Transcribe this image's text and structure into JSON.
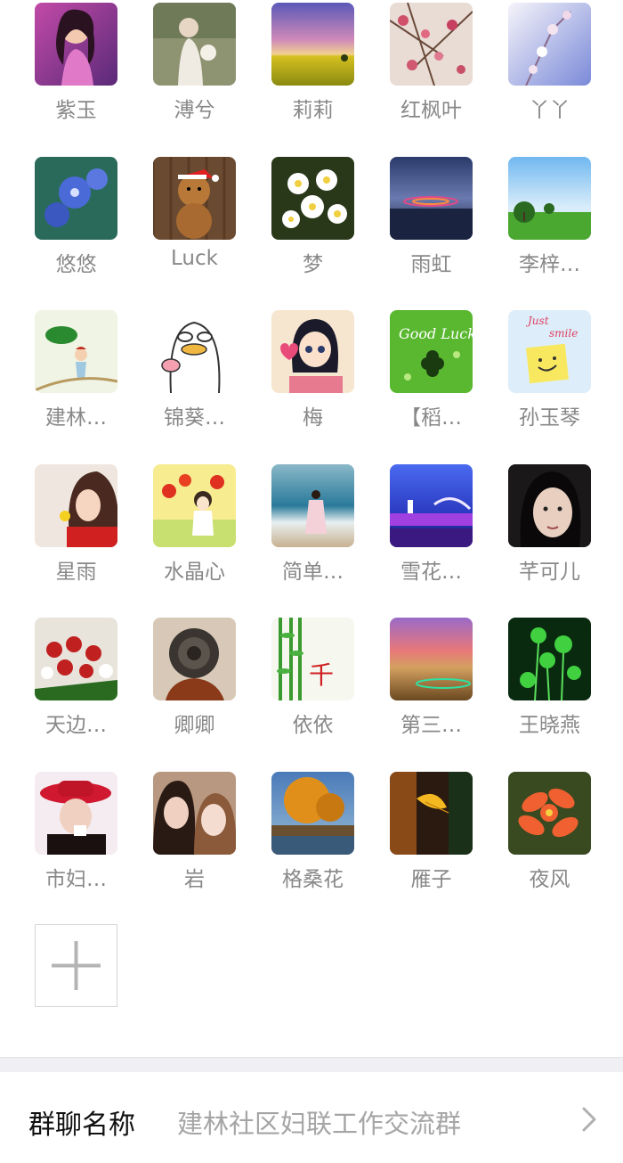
{
  "members": [
    {
      "name": "紫玉",
      "avatar": "portrait-cartoon-girl"
    },
    {
      "name": "溥兮",
      "avatar": "woman-with-flowers"
    },
    {
      "name": "莉莉",
      "avatar": "sunset-field"
    },
    {
      "name": "红枫叶",
      "avatar": "plum-blossoms"
    },
    {
      "name": "丫丫",
      "avatar": "white-blossoms-sky"
    },
    {
      "name": "悠悠",
      "avatar": "blue-flowers"
    },
    {
      "name": "Luck",
      "avatar": "teddy-bear-santa-hat"
    },
    {
      "name": "梦",
      "avatar": "white-frangipani"
    },
    {
      "name": "雨虹",
      "avatar": "night-lake-lights"
    },
    {
      "name": "李梓…",
      "avatar": "trees-green-field"
    },
    {
      "name": "建林…",
      "avatar": "cartoon-child-leaf"
    },
    {
      "name": "锦葵…",
      "avatar": "cartoon-duck"
    },
    {
      "name": "梅",
      "avatar": "anime-girl-heart"
    },
    {
      "name": "【稻…",
      "avatar": "good-luck-clover"
    },
    {
      "name": "孙玉琴",
      "avatar": "just-smile-note"
    },
    {
      "name": "星雨",
      "avatar": "woman-smelling-flower"
    },
    {
      "name": "水晶心",
      "avatar": "cartoon-girl-poppies"
    },
    {
      "name": "简单…",
      "avatar": "woman-on-beach"
    },
    {
      "name": "雪花…",
      "avatar": "purple-fountain-night"
    },
    {
      "name": "芊可儿",
      "avatar": "young-woman-selfie"
    },
    {
      "name": "天边…",
      "avatar": "red-roses-lilies"
    },
    {
      "name": "卿卿",
      "avatar": "ornate-carving"
    },
    {
      "name": "依依",
      "avatar": "bamboo-calligraphy"
    },
    {
      "name": "第三…",
      "avatar": "desert-sunset"
    },
    {
      "name": "王晓燕",
      "avatar": "green-sprouts"
    },
    {
      "name": "市妇…",
      "avatar": "woman-red-hat"
    },
    {
      "name": "岩",
      "avatar": "two-women-selfie"
    },
    {
      "name": "格桑花",
      "avatar": "golden-autumn-tree"
    },
    {
      "name": "雁子",
      "avatar": "yellow-leaf"
    },
    {
      "name": "夜风",
      "avatar": "orange-flower"
    }
  ],
  "add_member_icon": "plus-icon",
  "group_name_row": {
    "label": "群聊名称",
    "value": "建林社区妇联工作交流群",
    "icon": "chevron-right-icon"
  },
  "colors": {
    "name_text": "#888888",
    "separator": "#efeff4",
    "value_text": "#a5a5a5"
  }
}
